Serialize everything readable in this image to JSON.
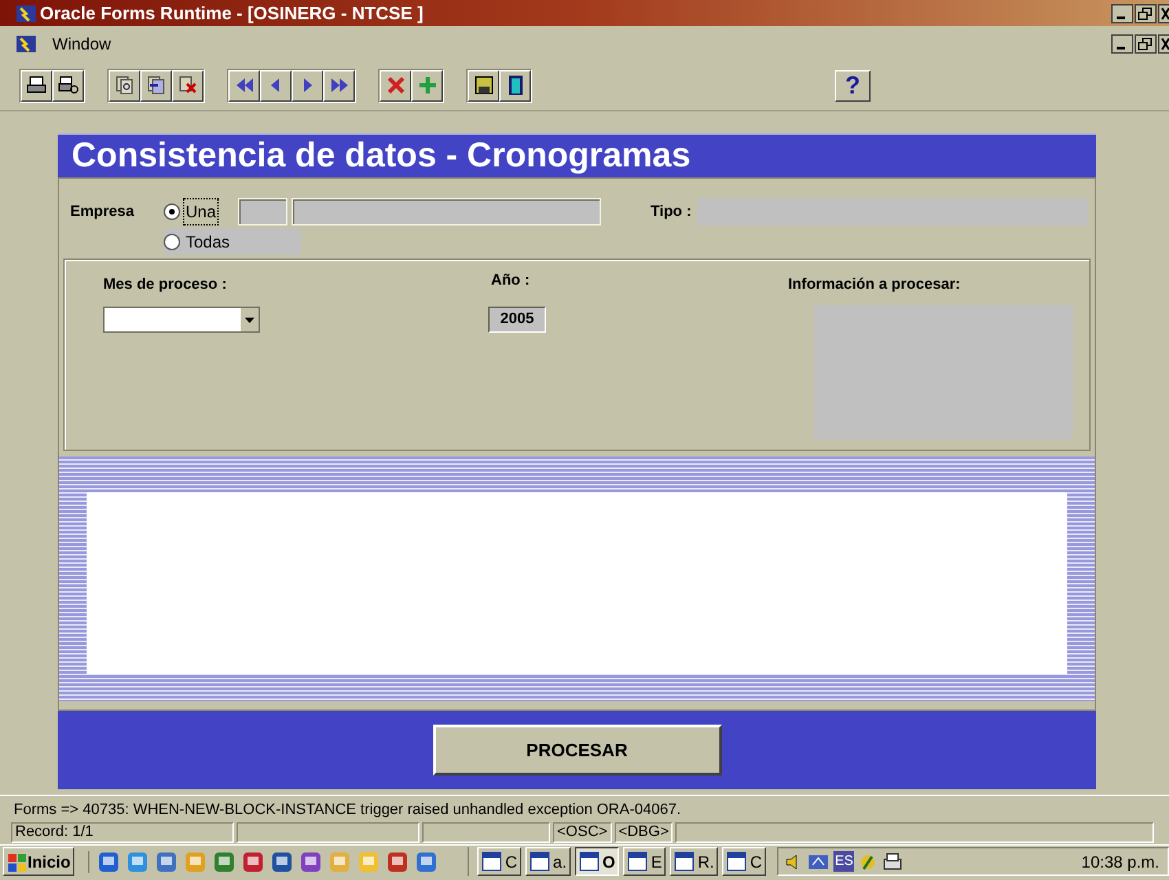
{
  "window": {
    "title": "Oracle Forms Runtime - [OSINERG - NTCSE ]"
  },
  "menu": [
    "Window"
  ],
  "toolbar": {
    "help": "?"
  },
  "form": {
    "title": "Consistencia de datos - Cronogramas",
    "empresa": {
      "label": "Empresa",
      "options": [
        {
          "label": "Una",
          "selected": true
        },
        {
          "label": "Todas",
          "selected": false
        }
      ]
    },
    "tipo": {
      "label": "Tipo :"
    },
    "mes": {
      "label": "Mes de proceso :"
    },
    "anio": {
      "label": "Año :",
      "value": "2005"
    },
    "informacion": {
      "label": "Información a procesar:"
    },
    "button": "PROCESAR"
  },
  "status": {
    "message": "Forms => 40735: WHEN-NEW-BLOCK-INSTANCE trigger raised unhandled exception ORA-04067.",
    "record": "Record: 1/1",
    "indicators": [
      "<OSC>",
      "<DBG>"
    ]
  },
  "taskbar": {
    "start": "Inicio",
    "tasks": [
      {
        "label": "C",
        "selected": false
      },
      {
        "label": "a.",
        "selected": false
      },
      {
        "label": "O",
        "selected": true
      },
      {
        "label": "E",
        "selected": false
      },
      {
        "label": "R.",
        "selected": false
      },
      {
        "label": "C",
        "selected": false
      }
    ],
    "tray": [
      "ES"
    ],
    "clock": "10:38 p.m."
  }
}
